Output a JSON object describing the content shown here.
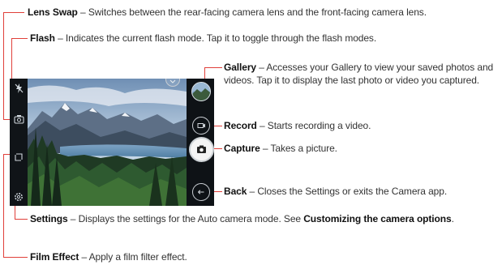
{
  "callouts": {
    "lens_swap": {
      "term": "Lens Swap",
      "desc": " – Switches between the rear-facing camera lens and the front-facing camera lens."
    },
    "flash": {
      "term": "Flash",
      "desc": " – Indicates the current flash mode. Tap it to toggle through the flash modes."
    },
    "gallery": {
      "term": "Gallery",
      "desc": " – Accesses your Gallery to view your saved photos and videos. Tap it to display the last photo or video you captured."
    },
    "record": {
      "term": "Record",
      "desc": " – Starts recording a video."
    },
    "capture": {
      "term": "Capture",
      "desc": " – Takes a picture."
    },
    "back": {
      "term": "Back",
      "desc": " – Closes the Settings or exits the Camera app."
    },
    "settings": {
      "term": "Settings",
      "desc": " – Displays the settings for the Auto camera mode. See ",
      "link": "Customizing the camera options",
      "end": "."
    },
    "film_effect": {
      "term": "Film Effect",
      "desc": " – Apply a film filter effect."
    }
  },
  "icons": {
    "flash": "flash-off-icon",
    "lens_swap": "lens-swap-icon",
    "film_effect": "film-effect-icon",
    "settings": "settings-gear-icon",
    "gallery": "gallery-thumbnail",
    "record": "video-record-icon",
    "capture": "camera-shutter-icon",
    "back": "back-arrow-icon",
    "mode": "chevron-down-icon"
  },
  "colors": {
    "leader_line": "#e0403a"
  }
}
